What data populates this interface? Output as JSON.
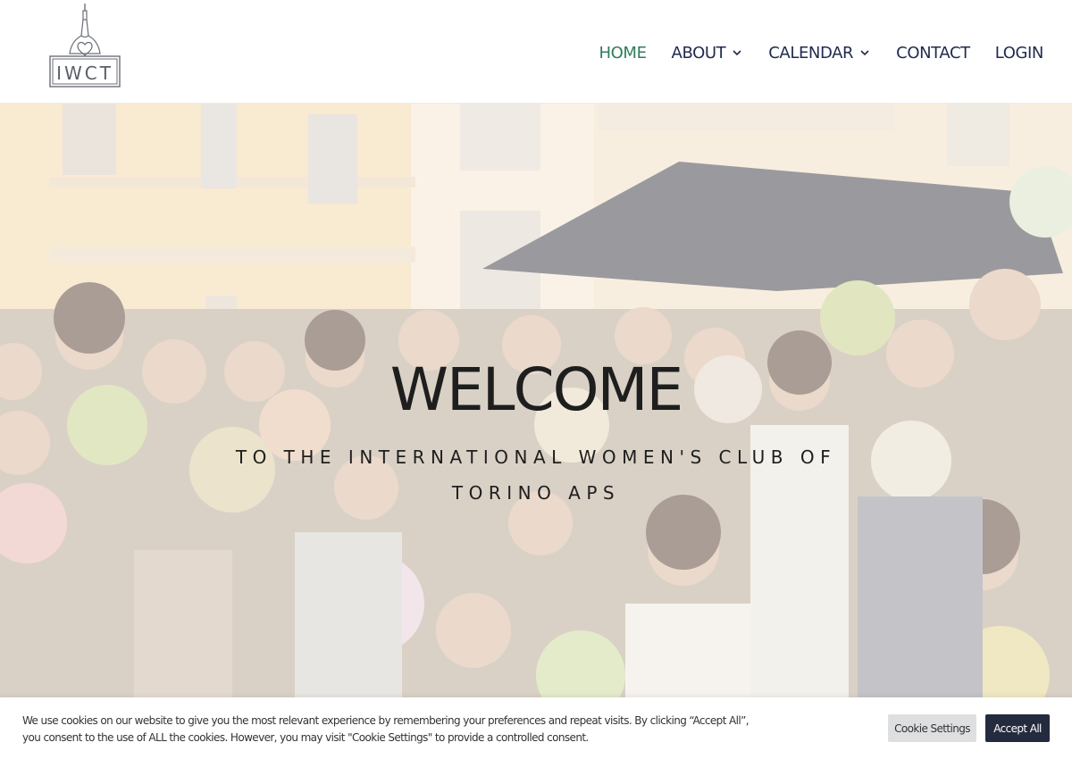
{
  "header": {
    "logo_text": "IWCT",
    "nav": [
      {
        "label": "HOME",
        "active": true,
        "has_dropdown": false
      },
      {
        "label": "ABOUT",
        "active": false,
        "has_dropdown": true
      },
      {
        "label": "CALENDAR",
        "active": false,
        "has_dropdown": true
      },
      {
        "label": "CONTACT",
        "active": false,
        "has_dropdown": false
      },
      {
        "label": "LOGIN",
        "active": false,
        "has_dropdown": false
      }
    ]
  },
  "hero": {
    "title": "WELCOME",
    "subtitle_line1": "TO THE INTERNATIONAL WOMEN'S CLUB OF",
    "subtitle_line2": "TORINO APS"
  },
  "cookie": {
    "line1": "We use cookies on our website to give you the most relevant experience by remembering your preferences and repeat visits. By clicking “Accept All”,",
    "line2": "you consent to the use of ALL the cookies. However, you may visit \"Cookie Settings\" to provide a controlled consent.",
    "settings_label": "Cookie Settings",
    "accept_label": "Accept All"
  },
  "colors": {
    "nav_text": "#1f2b4d",
    "nav_active": "#2e7d5b",
    "accept_bg": "#252b3e",
    "settings_bg": "#dedfe0"
  }
}
